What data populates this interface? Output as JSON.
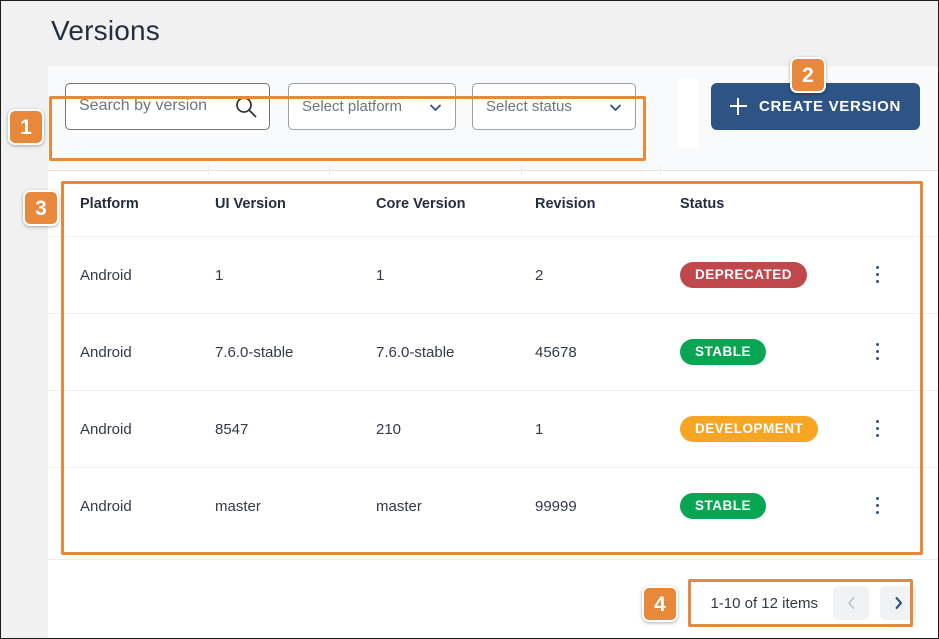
{
  "page": {
    "title": "Versions"
  },
  "toolbar": {
    "search": {
      "placeholder": "Search by version",
      "value": "",
      "icon": "search-icon"
    },
    "platform_select": {
      "placeholder": "Select platform",
      "value": "",
      "icon": "chevron-down-icon"
    },
    "status_select": {
      "placeholder": "Select status",
      "value": "",
      "icon": "chevron-down-icon"
    },
    "create_button": {
      "label": "CREATE VERSION",
      "icon": "plus-icon",
      "color": "#2d5485"
    }
  },
  "table": {
    "columns": [
      "Platform",
      "UI Version",
      "Core Version",
      "Revision",
      "Status"
    ],
    "rows": [
      {
        "platform": "Android",
        "ui_version": "1",
        "core_version": "1",
        "revision": "2",
        "status": "DEPRECATED",
        "status_color": "#c0484c",
        "menu_icon": "kebab-menu-icon"
      },
      {
        "platform": "Android",
        "ui_version": "7.6.0-stable",
        "core_version": "7.6.0-stable",
        "revision": "45678",
        "status": "STABLE",
        "status_color": "#08a552",
        "menu_icon": "kebab-menu-icon"
      },
      {
        "platform": "Android",
        "ui_version": "8547",
        "core_version": "210",
        "revision": "1",
        "status": "DEVELOPMENT",
        "status_color": "#f6a623",
        "menu_icon": "kebab-menu-icon"
      },
      {
        "platform": "Android",
        "ui_version": "master",
        "core_version": "master",
        "revision": "99999",
        "status": "STABLE",
        "status_color": "#08a552",
        "menu_icon": "kebab-menu-icon"
      }
    ]
  },
  "pagination": {
    "range_label": "1-10 of 12 items",
    "prev_icon": "chevron-left-icon",
    "next_icon": "chevron-right-icon",
    "prev_enabled": false,
    "next_enabled": true
  },
  "callouts": {
    "accent_color": "#e8883a",
    "steps": [
      {
        "number": "1",
        "target": "filters-toolbar"
      },
      {
        "number": "2",
        "target": "create-version-button"
      },
      {
        "number": "3",
        "target": "versions-table"
      },
      {
        "number": "4",
        "target": "pagination"
      }
    ]
  }
}
